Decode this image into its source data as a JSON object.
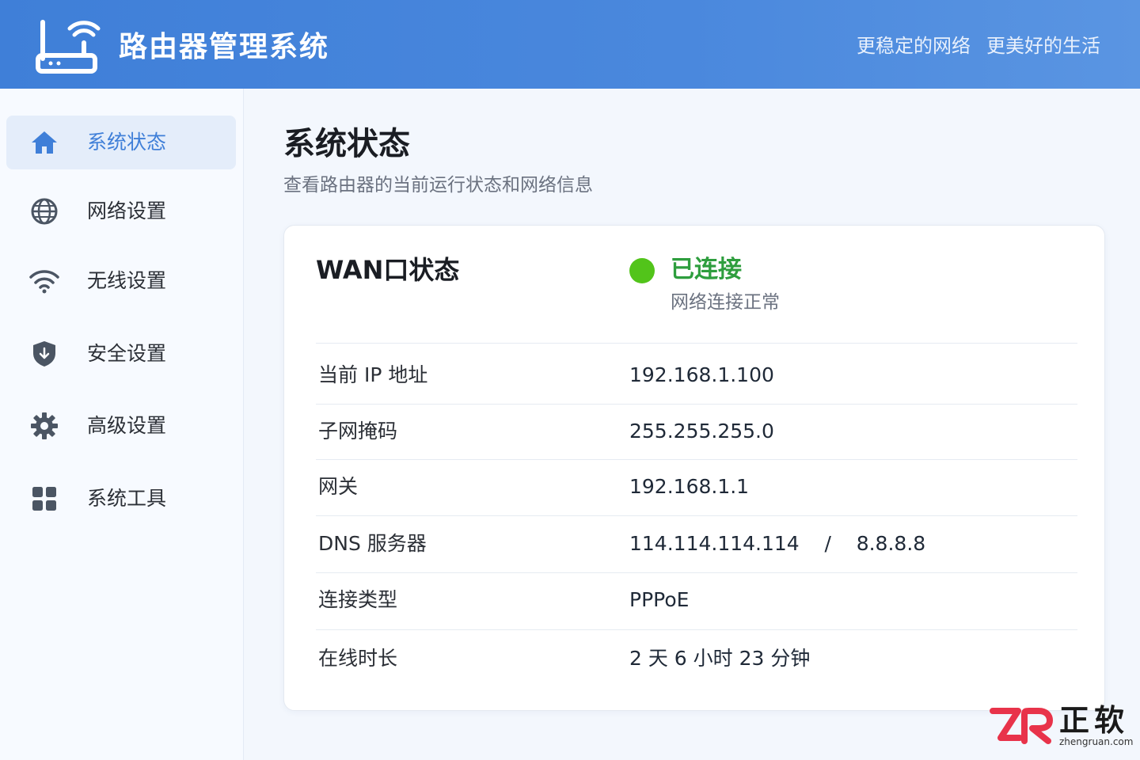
{
  "header": {
    "title": "路由器管理系统",
    "slogan_1": "更稳定的网络",
    "slogan_2": "更美好的生活"
  },
  "sidebar": {
    "items": [
      {
        "label": "系统状态",
        "icon": "home-icon",
        "active": true
      },
      {
        "label": "网络设置",
        "icon": "globe-icon",
        "active": false
      },
      {
        "label": "无线设置",
        "icon": "wifi-icon",
        "active": false
      },
      {
        "label": "安全设置",
        "icon": "shield-icon",
        "active": false
      },
      {
        "label": "高级设置",
        "icon": "gear-icon",
        "active": false
      },
      {
        "label": "系统工具",
        "icon": "grid-icon",
        "active": false
      }
    ]
  },
  "main": {
    "title": "系统状态",
    "subtitle": "查看路由器的当前运行状态和网络信息"
  },
  "wan": {
    "title": "WAN口状态",
    "status": "已连接",
    "status_desc": "网络连接正常",
    "rows": [
      {
        "label": "当前 IP 地址",
        "value": "192.168.1.100"
      },
      {
        "label": "子网掩码",
        "value": "255.255.255.0"
      },
      {
        "label": "网关",
        "value": "192.168.1.1"
      },
      {
        "label": "DNS 服务器",
        "value": "114.114.114.114    /    8.8.8.8"
      },
      {
        "label": "连接类型",
        "value": "PPPoE"
      },
      {
        "label": "在线时长",
        "value": "2 天 6 小时 23 分钟"
      }
    ]
  },
  "watermark": {
    "text": "正软",
    "url": "zhengruan.com"
  },
  "colors": {
    "header_blue": "#4a88dd",
    "accent": "#3f7fd8",
    "status_green": "#52c41a",
    "status_text_green": "#2e9e3e",
    "watermark_red": "#e8334a"
  }
}
